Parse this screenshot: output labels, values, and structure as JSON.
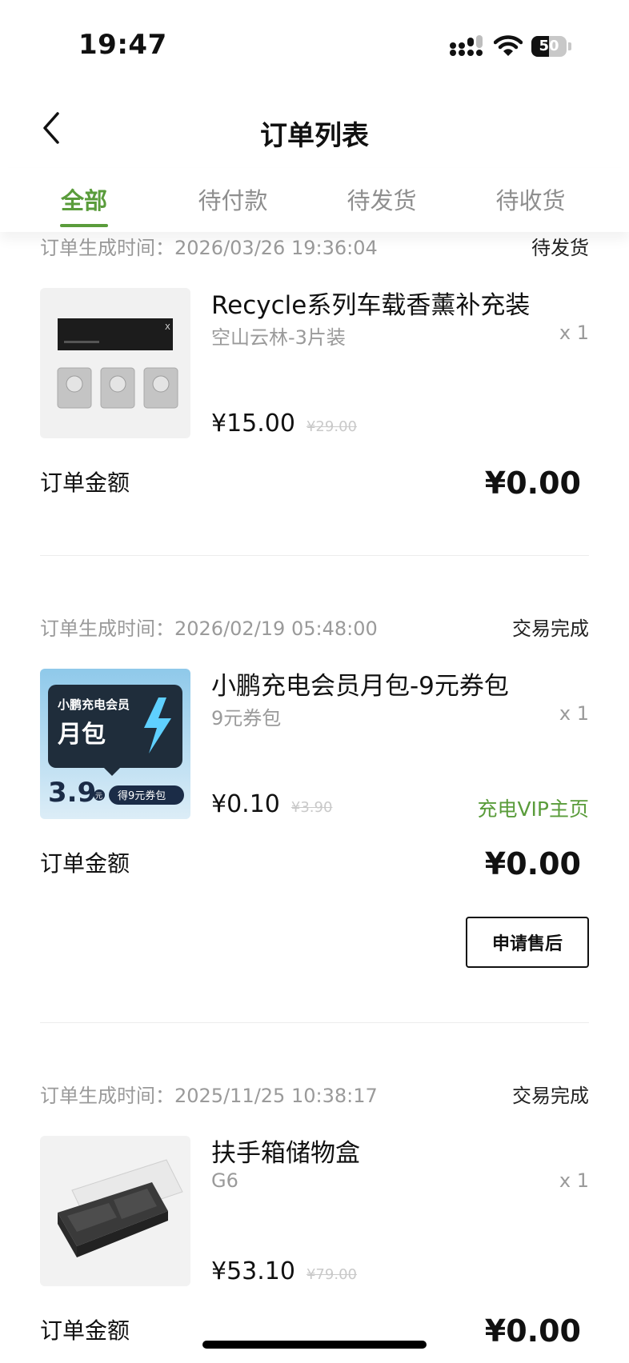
{
  "status_bar": {
    "time": "19:47",
    "battery": "50",
    "battery_level": 0.5
  },
  "header": {
    "title": "订单列表"
  },
  "tabs": [
    {
      "label": "全部",
      "active": true
    },
    {
      "label": "待付款",
      "active": false
    },
    {
      "label": "待发货",
      "active": false
    },
    {
      "label": "待收货",
      "active": false
    }
  ],
  "orders": [
    {
      "time": "订单生成时间：2026/03/26 19:36:04",
      "status": "待发货",
      "product": {
        "title": "Recycle系列车载香薰补充装",
        "variant": "空山云林-3片装",
        "qty": "x 1",
        "price": "¥15.00",
        "original_price": "¥29.00"
      },
      "amount_label": "订单金额",
      "amount": "¥0.00"
    },
    {
      "time": "订单生成时间：2026/02/19 05:48:00",
      "status": "交易完成",
      "product": {
        "title": "小鹏充电会员月包-9元券包",
        "variant": "9元券包",
        "qty": "x 1",
        "price": "¥0.10",
        "original_price": "¥3.90",
        "image_text": {
          "brand": "小鹏充电会员",
          "name": "月包",
          "price": "3.9",
          "unit": "元",
          "badge": "得9元券包"
        }
      },
      "link": "充电VIP主页",
      "amount_label": "订单金额",
      "amount": "¥0.00",
      "action": "申请售后"
    },
    {
      "time": "订单生成时间：2025/11/25 10:38:17",
      "status": "交易完成",
      "product": {
        "title": "扶手箱储物盒",
        "variant": "G6",
        "qty": "x 1",
        "price": "¥53.10",
        "original_price": "¥79.00"
      },
      "amount_label": "订单金额",
      "amount": "¥0.00"
    }
  ],
  "colors": {
    "accent": "#5a9c3b",
    "muted_text": "#9a9a9a",
    "strike_text": "#c9c9c9"
  },
  "icons": [
    "back-icon",
    "signal-icon",
    "wifi-icon",
    "battery-icon"
  ]
}
